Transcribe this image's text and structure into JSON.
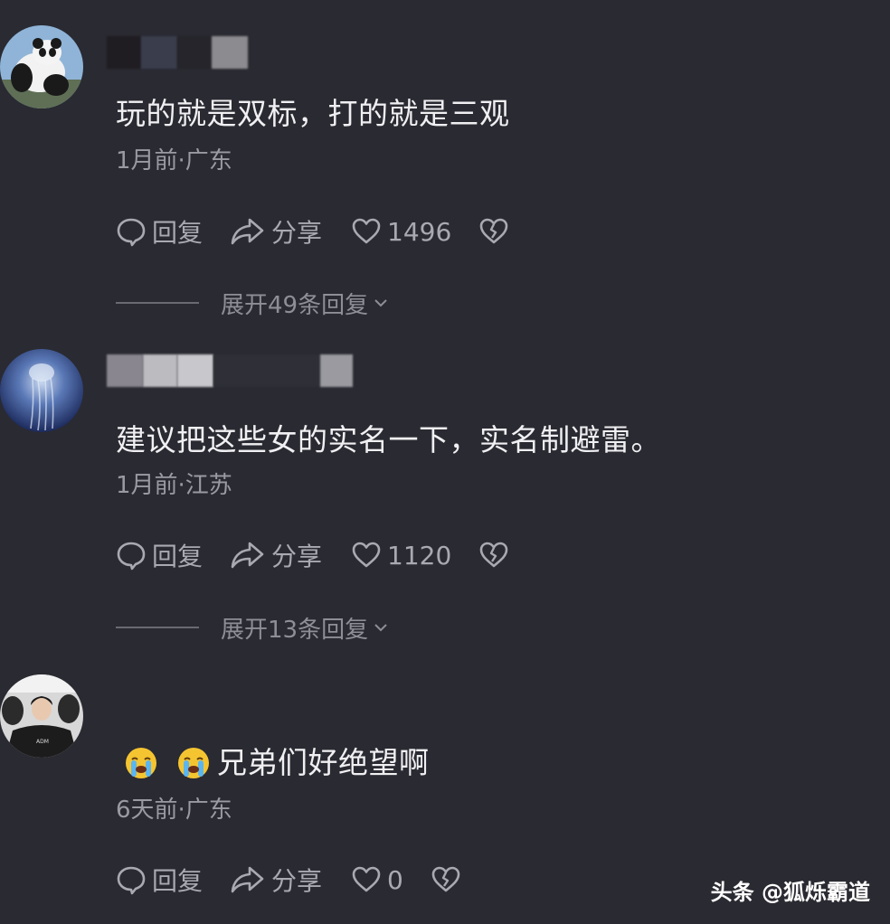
{
  "comments": [
    {
      "username": "",
      "text": "玩的就是双标，打的就是三观",
      "meta": "1月前·广东",
      "actions": {
        "reply": "回复",
        "share": "分享",
        "likes": "1496"
      },
      "expand": "展开49条回复"
    },
    {
      "username": "",
      "text": "建议把这些女的实名一下，实名制避雷。",
      "meta": "1月前·江苏",
      "actions": {
        "reply": "回复",
        "share": "分享",
        "likes": "1120"
      },
      "expand": "展开13条回复"
    },
    {
      "username": "",
      "emojis": [
        "loudly-crying-face",
        "loudly-crying-face"
      ],
      "text": "兄弟们好绝望啊",
      "meta": "6天前·广东",
      "actions": {
        "reply": "回复",
        "share": "分享",
        "likes": "0"
      }
    }
  ],
  "watermark": "头条 @狐烁霸道",
  "colors": {
    "background": "#2a2a32",
    "text": "#f0f0f3",
    "meta": "#9a9aa3",
    "action": "#a9a9b2"
  },
  "icons": [
    "reply-icon",
    "share-icon",
    "heart-icon",
    "broken-heart-icon",
    "chevron-down-icon"
  ]
}
